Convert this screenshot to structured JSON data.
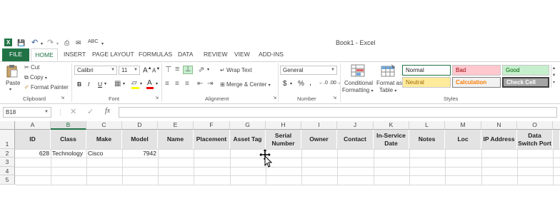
{
  "window": {
    "title": "Book1 - Excel"
  },
  "tabs": [
    "FILE",
    "HOME",
    "INSERT",
    "PAGE LAYOUT",
    "FORMULAS",
    "DATA",
    "REVIEW",
    "VIEW",
    "ADD-INS"
  ],
  "clipboard": {
    "paste": "Paste",
    "cut": "Cut",
    "copy": "Copy",
    "format_painter": "Format Painter",
    "group": "Clipboard"
  },
  "font": {
    "name": "Calibri",
    "size": "11",
    "grow": "A",
    "shrink": "A",
    "bold": "B",
    "italic": "I",
    "underline": "U",
    "group": "Font"
  },
  "alignment": {
    "wrap_text": "Wrap Text",
    "merge_center": "Merge & Center",
    "group": "Alignment"
  },
  "number": {
    "format": "General",
    "currency": "$",
    "percent": "%",
    "comma": ",",
    "group": "Number"
  },
  "styles": {
    "conditional_formatting_1": "Conditional",
    "conditional_formatting_2": "Formatting",
    "format_as_table_1": "Format as",
    "format_as_table_2": "Table",
    "normal": "Normal",
    "bad": "Bad",
    "good": "Good",
    "neutral": "Neutral",
    "calculation": "Calculation",
    "check_cell": "Check Cell",
    "group": "Styles"
  },
  "formula_bar": {
    "name_box": "B18",
    "fx": "fx",
    "value": ""
  },
  "columns": [
    "A",
    "B",
    "C",
    "D",
    "E",
    "F",
    "G",
    "H",
    "I",
    "J",
    "K",
    "L",
    "M",
    "N",
    "O"
  ],
  "rows": [
    "1",
    "2",
    "3",
    "4",
    "5"
  ],
  "headers": [
    [
      "ID",
      ""
    ],
    [
      "Class",
      ""
    ],
    [
      "Make",
      ""
    ],
    [
      "Model",
      ""
    ],
    [
      "Name",
      ""
    ],
    [
      "Placement",
      ""
    ],
    [
      "Asset Tag",
      ""
    ],
    [
      "Serial",
      "Number"
    ],
    [
      "Owner",
      ""
    ],
    [
      "Contact",
      ""
    ],
    [
      "In-Service",
      "Date"
    ],
    [
      "Notes",
      ""
    ],
    [
      "Loc",
      ""
    ],
    [
      "IP Address",
      ""
    ],
    [
      "Data",
      "Switch Port"
    ]
  ],
  "row2": {
    "id": "628",
    "class": "Technology",
    "make": "Cisco",
    "model": "7942"
  },
  "colors": {
    "excel_green": "#217346",
    "header_fill": "#e3e3e3",
    "bad_fill": "#ffc7ce",
    "good_fill": "#c6efce",
    "neutral_fill": "#ffeb9c",
    "check_fill": "#a5a5a5"
  }
}
